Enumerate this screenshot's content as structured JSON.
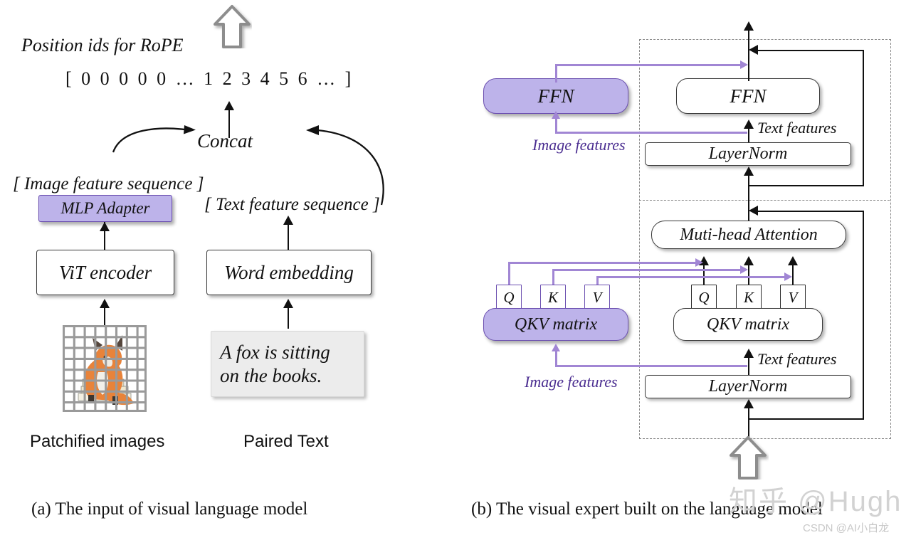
{
  "figure": {
    "panel_a": {
      "caption": "(a) The input of visual language model",
      "position_ids_label": "Position ids for RoPE",
      "position_ids_sequence": "[  0  0  0  0  0  …  1  2  3  4  5  6  …  ]",
      "concat_label": "Concat",
      "image_feature_sequence": "[ Image feature sequence ]",
      "text_feature_sequence": "[ Text  feature sequence ]",
      "mlp_adapter": "MLP Adapter",
      "vit_encoder": "ViT encoder",
      "word_embedding": "Word embedding",
      "sample_text_line1": "A fox is sitting",
      "sample_text_line2": "on the books.",
      "patchified_images_label": "Patchified images",
      "paired_text_label": "Paired Text"
    },
    "panel_b": {
      "caption": "(b) The visual expert built on the language model",
      "image_expert": {
        "ffn": "FFN",
        "qkv_matrix": "QKV matrix",
        "q": "Q",
        "k": "K",
        "v": "V",
        "features_label_top": "Image features",
        "features_label_bottom": "Image features"
      },
      "language_model": {
        "ffn": "FFN",
        "layernorm_top": "LayerNorm",
        "attention": "Muti-head Attention",
        "qkv_matrix": "QKV matrix",
        "layernorm_bottom": "LayerNorm",
        "q": "Q",
        "k": "K",
        "v": "V",
        "features_label_top": "Text features",
        "features_label_bottom": "Text features"
      }
    }
  },
  "watermarks": {
    "zhihu": "知乎 @Hugh",
    "csdn": "CSDN @AI小白龙"
  },
  "colors": {
    "expert_fill": "#bdb3ea",
    "expert_border": "#6b4fb0",
    "expert_arrow": "#a186d4",
    "feature_label": "#4b2e91",
    "box_border": "#3a3a3a"
  }
}
